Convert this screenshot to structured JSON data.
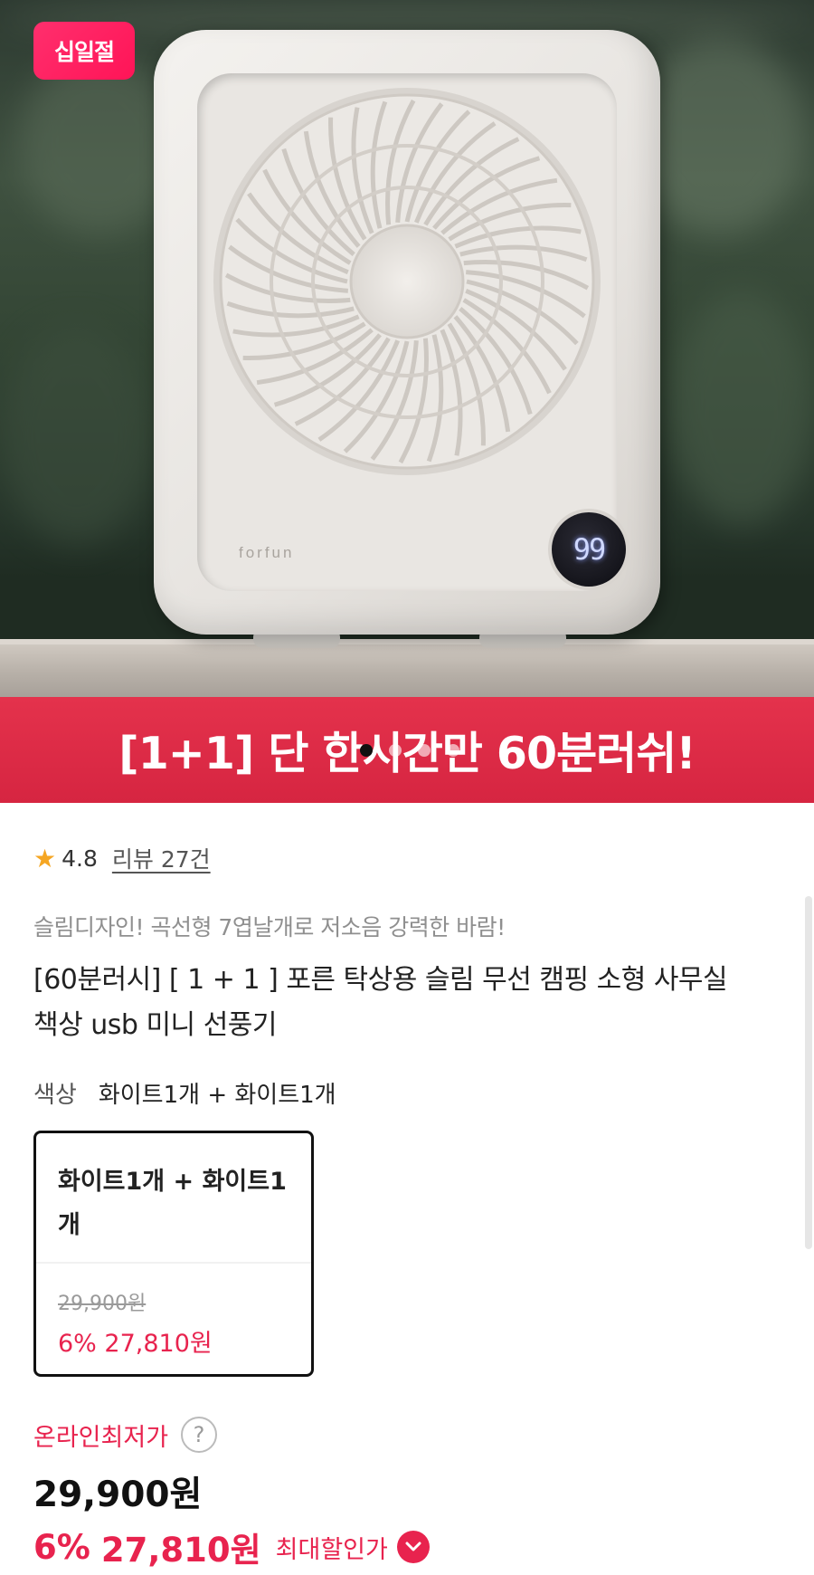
{
  "hero": {
    "badge": "십일절",
    "banner": "[1+1] 단 한시간만 60분러쉬!",
    "fan_brand": "forfun",
    "fan_display": "99",
    "carousel": {
      "count": 4,
      "active": 1
    }
  },
  "rating": {
    "score": "4.8",
    "reviews": "리뷰 27건"
  },
  "product": {
    "subtitle": "슬림디자인! 곡선형 7엽날개로 저소음 강력한 바람!",
    "title": "[60분러시] [ 1 + 1 ] 포른 탁상용 슬림 무선 캠핑 소형 사무실 책상 usb 미니 선풍기"
  },
  "color_option": {
    "label": "색상",
    "value": "화이트1개 + 화이트1개"
  },
  "option_card": {
    "name": "화이트1개 + 화이트1개",
    "original_price": "29,900원",
    "sale": "6% 27,810원"
  },
  "price": {
    "lowest_label": "온라인최저가",
    "help": "?",
    "original": "29,900원",
    "discount_pct": "6%",
    "sale_price": "27,810원",
    "max_discount_label": "최대할인가"
  },
  "colors": {
    "accent": "#e8234e",
    "banner": "#d62541",
    "badge": "#ff1457"
  }
}
